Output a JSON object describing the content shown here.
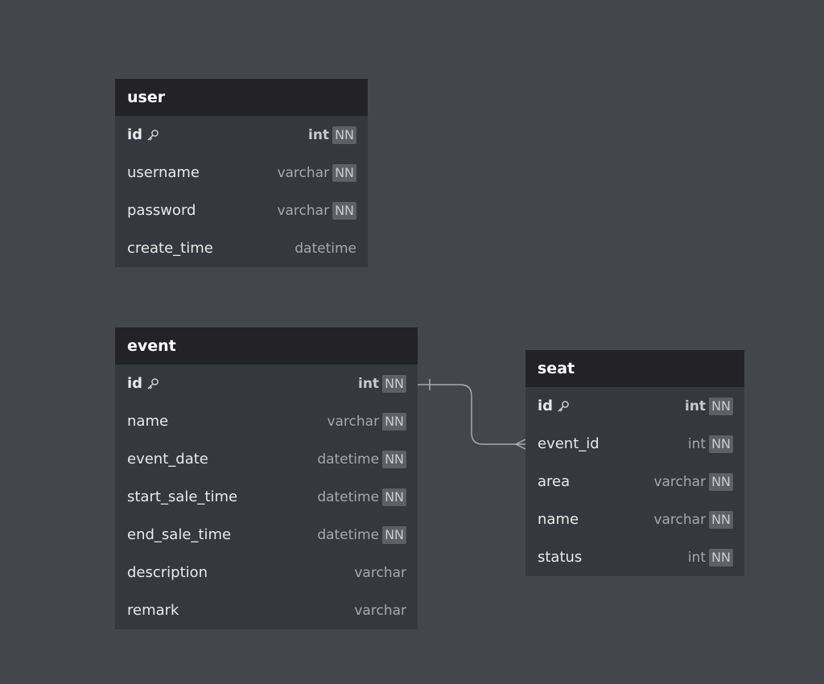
{
  "entities": [
    {
      "name": "user",
      "columns": [
        {
          "name": "id",
          "type": "int",
          "pk": true,
          "nn": true
        },
        {
          "name": "username",
          "type": "varchar",
          "pk": false,
          "nn": true
        },
        {
          "name": "password",
          "type": "varchar",
          "pk": false,
          "nn": true
        },
        {
          "name": "create_time",
          "type": "datetime",
          "pk": false,
          "nn": false
        }
      ]
    },
    {
      "name": "event",
      "columns": [
        {
          "name": "id",
          "type": "int",
          "pk": true,
          "nn": true
        },
        {
          "name": "name",
          "type": "varchar",
          "pk": false,
          "nn": true
        },
        {
          "name": "event_date",
          "type": "datetime",
          "pk": false,
          "nn": true
        },
        {
          "name": "start_sale_time",
          "type": "datetime",
          "pk": false,
          "nn": true
        },
        {
          "name": "end_sale_time",
          "type": "datetime",
          "pk": false,
          "nn": true
        },
        {
          "name": "description",
          "type": "varchar",
          "pk": false,
          "nn": false
        },
        {
          "name": "remark",
          "type": "varchar",
          "pk": false,
          "nn": false
        }
      ]
    },
    {
      "name": "seat",
      "columns": [
        {
          "name": "id",
          "type": "int",
          "pk": true,
          "nn": true
        },
        {
          "name": "event_id",
          "type": "int",
          "pk": false,
          "nn": true
        },
        {
          "name": "area",
          "type": "varchar",
          "pk": false,
          "nn": true
        },
        {
          "name": "name",
          "type": "varchar",
          "pk": false,
          "nn": true
        },
        {
          "name": "status",
          "type": "int",
          "pk": false,
          "nn": true
        }
      ]
    }
  ],
  "nn_label": "NN",
  "relations": [
    {
      "from_table": "event",
      "from_column": "id",
      "to_table": "seat",
      "to_column": "event_id",
      "cardinality": "one-to-many"
    }
  ],
  "colors": {
    "canvas": "#45464c",
    "table_body": "#37383d",
    "table_header": "#232325",
    "relation_line": "#a9aaaf"
  },
  "icons": {
    "primary_key": "key-icon"
  }
}
